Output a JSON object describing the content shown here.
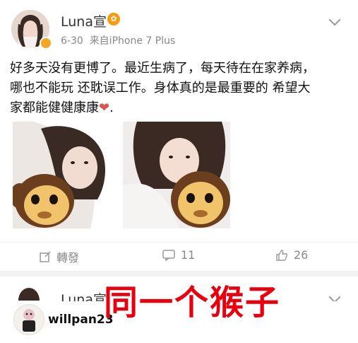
{
  "post1": {
    "username": "Luna宣",
    "time": "6-30",
    "device": "来自iPhone 7 Plus",
    "content_line1": "好多天没有更博了。最近生病了，每天待在在家养病，",
    "content_line2": "哪也不能玩 还耽误工作。身体真的是最重要的 希望大",
    "content_line3_prefix": "家都能健健康康",
    "content_line3_suffix": ".",
    "actions": {
      "repost_label": "轉發",
      "comment_count": "11",
      "like_count": "26"
    }
  },
  "post2": {
    "username": "Luna宣"
  },
  "overlay": {
    "title": "同一个猴子"
  },
  "watermark": {
    "handle": "willpan23"
  },
  "icons": {
    "heart": "heart-emoji",
    "vip": "vip-badge",
    "repost": "repost-icon",
    "comment": "comment-icon",
    "like": "like-icon"
  }
}
